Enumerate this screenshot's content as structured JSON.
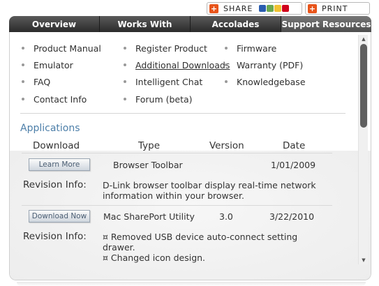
{
  "share": {
    "label": "SHARE",
    "mini_icon_colors": [
      "#2a5db0",
      "#6aa84f",
      "#f1c232",
      "#d0021b"
    ]
  },
  "print": {
    "label": "PRINT"
  },
  "nav": {
    "tabs": [
      {
        "label": "Overview"
      },
      {
        "label": "Works With"
      },
      {
        "label": "Accolades"
      },
      {
        "label": "Support Resources"
      }
    ],
    "active_index": 3
  },
  "links": {
    "col1": [
      "Product Manual",
      "Emulator",
      "FAQ",
      "Contact Info"
    ],
    "col2": [
      "Register Product",
      "Additional Downloads",
      "Intelligent Chat",
      "Forum (beta)"
    ],
    "col3": [
      "Firmware",
      "Warranty (PDF)",
      "Knowledgebase"
    ]
  },
  "applications": {
    "title": "Applications",
    "headers": {
      "download": "Download",
      "type": "Type",
      "version": "Version",
      "date": "Date"
    },
    "rows": [
      {
        "button": "Learn More",
        "type": "Browser Toolbar",
        "version": "",
        "date": "1/01/2009",
        "revision_label": "Revision Info:",
        "revision_lines": [
          "D-Link browser toolbar display real-time network",
          "information within your browser."
        ]
      },
      {
        "button": "Download Now",
        "type": "Mac SharePort Utility",
        "version": "3.0",
        "date": "3/22/2010",
        "revision_label": "Revision Info:",
        "revision_lines": [
          "¤ Removed USB device auto-connect setting",
          "drawer.",
          "¤ Changed icon design."
        ]
      }
    ]
  },
  "colors": {
    "accent": "#4d7fa9",
    "nav_bg": "#2b2b2b",
    "share_icon": "#e8541a"
  }
}
